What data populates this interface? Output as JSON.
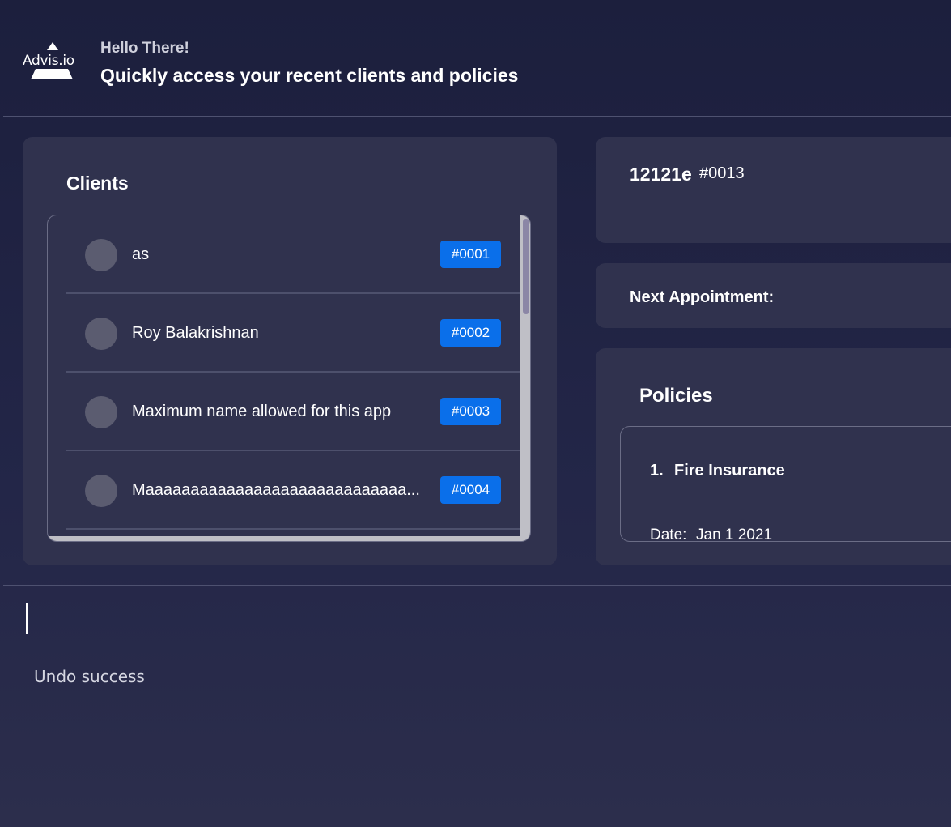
{
  "header": {
    "logo_text": "Advis.io",
    "greeting": "Hello There!",
    "subtitle": "Quickly access your recent clients and policies"
  },
  "clients": {
    "title": "Clients",
    "items": [
      {
        "name": "as",
        "id": "#0001"
      },
      {
        "name": "Roy Balakrishnan",
        "id": "#0002"
      },
      {
        "name": "Maximum name allowed for this app",
        "id": "#0003"
      },
      {
        "name": "Maaaaaaaaaaaaaaaaaaaaaaaaaaaaa...",
        "id": "#0004"
      }
    ]
  },
  "person": {
    "name": "12121e",
    "id": "#0013"
  },
  "appointment": {
    "label": "Next Appointment:"
  },
  "policies": {
    "title": "Policies",
    "items": [
      {
        "number": "1.",
        "name": "Fire Insurance",
        "date_label": "Date:",
        "date": "Jan 1 2021"
      }
    ]
  },
  "command": {
    "value": "",
    "result": "Undo success"
  },
  "colors": {
    "background": "#1e2140",
    "panel": "#30324e",
    "id_badge": "#0a6fea"
  }
}
